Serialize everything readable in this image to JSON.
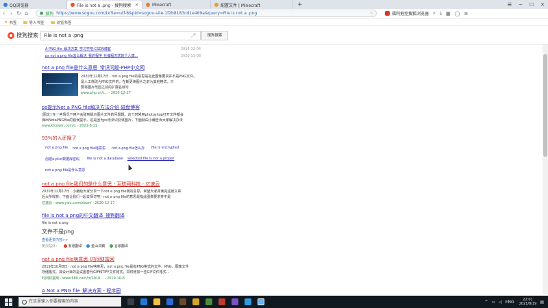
{
  "tabs": [
    {
      "label": "QQ浏览器",
      "color": "#2f7be8",
      "active": false
    },
    {
      "label": "File is not a .png - 搜狗搜索",
      "color": "#f0502b",
      "active": true
    },
    {
      "label": "Minecraft",
      "color": "#f07a2b",
      "active": false
    },
    {
      "label": "配置文件 | Minecraft",
      "color": "#e8a030",
      "active": false
    }
  ],
  "address": {
    "url": "https://www.sogou.com/tx?ie=utf-8&pid=sogou-site-1f2b8183cd1e469a&query=File is not a .png",
    "secure_label": "搜狗",
    "promo": "福利把控搜狐浏览器"
  },
  "bookmarks": [
    {
      "label": "书签"
    },
    {
      "label": "导入书签"
    },
    {
      "label": "浏览书签"
    }
  ],
  "search": {
    "logo_text": "搜狗搜索",
    "query": "File is not a .png",
    "button": "搜狗搜索"
  },
  "top_links": [
    {
      "title": "A PNG file_解决方案_学习学吧-CSDN博客",
      "date": "2014-12-04"
    },
    {
      "title": "ps not a png file怎么解决_我的程序_社编程无忧的个人博...",
      "date": "2020-11-08"
    }
  ],
  "results": [
    {
      "title": "not a png file是什么意思_常识问题-PHP中文网",
      "snippet": [
        "2020年12月17日 · not a png file的意思是指此图像要求并不是PNG文件。",
        "是人工修改为PNG文件的，在断更读图片之前为其他格式，只",
        "要将图片改回之前的扩展名就可"
      ],
      "cite": "www.php.cn/t... - 2020-12-17"
    },
    {
      "title": "ps提示Not a PNG file解决方法介绍 磁盘博客",
      "snippet": [
        "[图文] 在一些情况下用户会碰到提示图片文件的问题题。这个时候用photoshop打开文件都会",
        "弹出NotaPNGfile的错误提示。这是因为ps无法识别该图片，下面就由小编告诉大家解决办法"
      ],
      "cite": "www.kfcqwm.com/1 - 2021-8-11"
    },
    {
      "title": "not a png file我们的是什么意思 - 互联网科技 - 亿速云",
      "snippet": [
        "2020年12月17日 · 小编给大家分享一下not a png file我的意思，希望大家阅读完这篇文章",
        "后大所收获，下面让我们一起去探讨吧！not a png file的意思是指此图像要求并不是"
      ],
      "cite": "亿速云 - www.yisu.com/zixun/ - 2020-12-17"
    }
  ],
  "related": {
    "heading": "93%的人还搜了",
    "items": [
      "not a png file",
      "not a png file啥意思",
      "not a png file怎么办",
      "file is encrypted",
      "创建a.plist数据库密码",
      "file is not a database",
      "selected file is not a proper",
      "not a png file是什么意思"
    ]
  },
  "translate": {
    "title": "file is not a png的中文翻译_搜狗翻译",
    "source": "file is not a png",
    "result": "文件不是png",
    "more": "查看更多内容>>",
    "label": "英汉站外：",
    "dict1": "有道翻译",
    "dict2": "金山词霸",
    "dict3": "谷歌翻译"
  },
  "result4": {
    "title": "not a png file啥意思_时间财富网",
    "snippet": [
      "2019年10月8日 · not a png file啥意思，not a png file是指PNG格式的文件。PNG，图像文件",
      "存储格式。其设计目的是试图替代GIF和TIFF文件格式，同时增加一些GIF文件格式..."
    ],
    "cite": "时间财富网 - www.680.com/tr/1910... - 2019-10-8"
  },
  "result5": {
    "title": "A Not a PNG file_解决方案 - 程序园"
  },
  "taskbar": {
    "search_placeholder": "在这里输入你要搜索的内容",
    "lang": "ENG",
    "time": "22:01",
    "date": "2021/8/19"
  }
}
